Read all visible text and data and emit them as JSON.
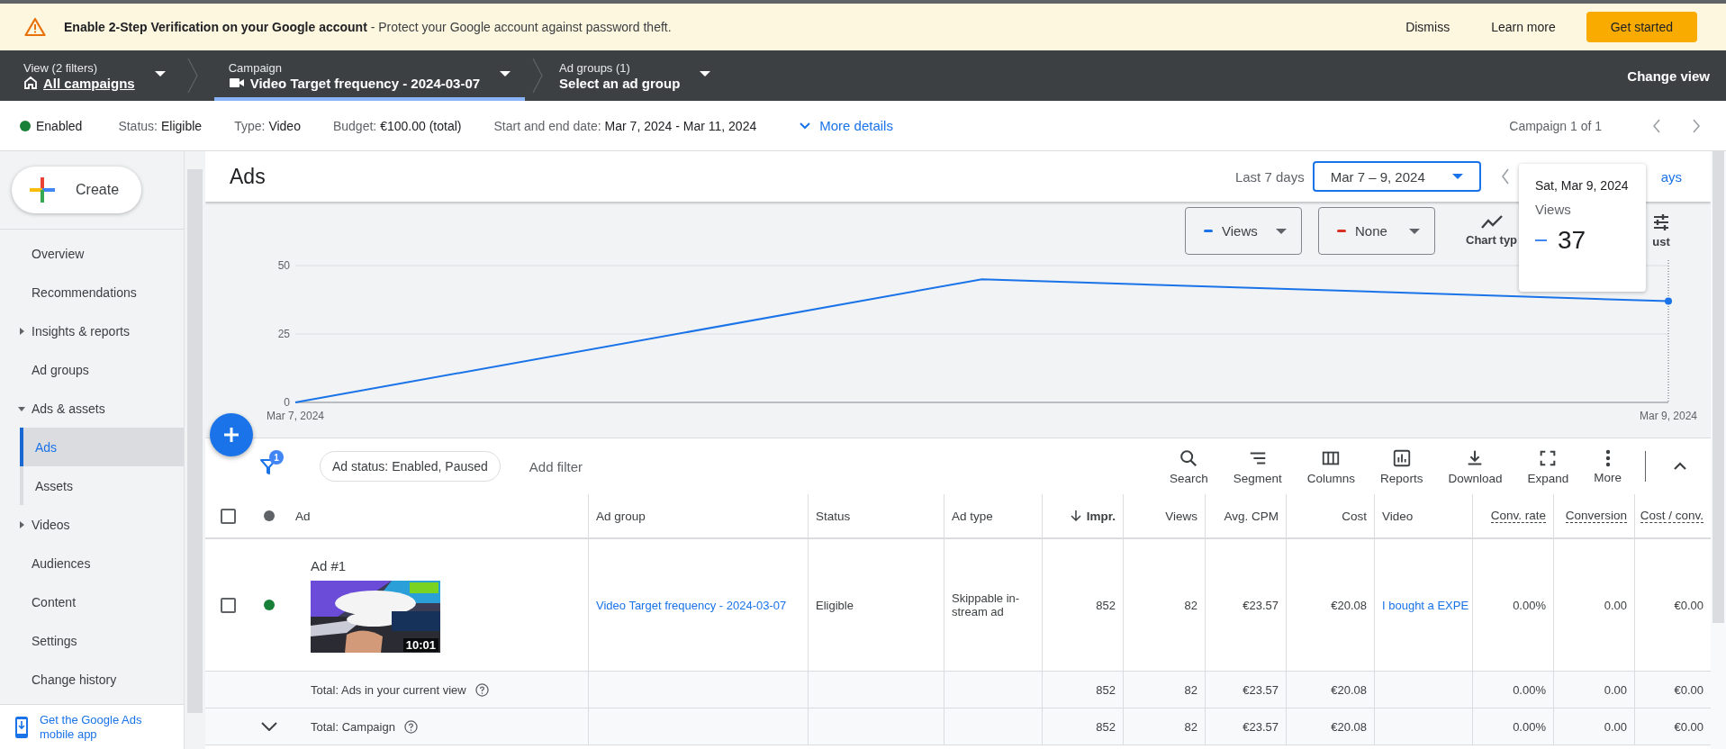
{
  "banner": {
    "title": "Enable 2-Step Verification on your Google account",
    "message": " - Protect your Google account against password theft.",
    "actions": [
      "Dismiss",
      "Learn more"
    ],
    "primary": "Get started"
  },
  "nav": {
    "crumbs": [
      {
        "kind": "view",
        "label": "View (2 filters)",
        "value": "All campaigns",
        "selected": false
      },
      {
        "kind": "campaign",
        "label": "Campaign",
        "value": "Video Target frequency - 2024-03-07",
        "selected": true
      },
      {
        "kind": "adgroup",
        "label": "Ad groups (1)",
        "value": "Select an ad group",
        "selected": false
      }
    ],
    "change_view": "Change view"
  },
  "summary": {
    "state": "Enabled",
    "fields": [
      {
        "label": "Status:",
        "value": "Eligible"
      },
      {
        "label": "Type:",
        "value": "Video"
      },
      {
        "label": "Budget:",
        "value": "€100.00 (total)"
      },
      {
        "label": "Start and end date:",
        "value": "Mar 7, 2024 - Mar 11, 2024"
      }
    ],
    "more": "More details",
    "pager": "Campaign 1 of 1"
  },
  "sidebar": {
    "create": "Create",
    "items": [
      {
        "kind": "link",
        "label": "Overview",
        "selected": false
      },
      {
        "kind": "link",
        "label": "Recommendations",
        "selected": false
      },
      {
        "kind": "group",
        "label": "Insights & reports",
        "expanded": false,
        "selected": false
      },
      {
        "kind": "link",
        "label": "Ad groups",
        "selected": false
      },
      {
        "kind": "group",
        "label": "Ads & assets",
        "expanded": true,
        "selected": false
      },
      {
        "kind": "child",
        "label": "Ads",
        "selected": true
      },
      {
        "kind": "child",
        "label": "Assets",
        "selected": false
      },
      {
        "kind": "group",
        "label": "Videos",
        "expanded": false,
        "selected": false
      },
      {
        "kind": "link",
        "label": "Audiences",
        "selected": false
      },
      {
        "kind": "link",
        "label": "Content",
        "selected": false
      },
      {
        "kind": "link",
        "label": "Settings",
        "selected": false
      },
      {
        "kind": "link",
        "label": "Change history",
        "selected": false
      }
    ],
    "footer": "Get the Google Ads mobile app"
  },
  "page": {
    "title": "Ads",
    "range_label": "Last 7 days",
    "date_range": "Mar 7 – 9, 2024",
    "cut_link": "ays"
  },
  "chart": {
    "metrics": [
      {
        "label": "Views",
        "color": "#1a73e8"
      },
      {
        "label": "None",
        "color": "#d93025"
      }
    ],
    "tools": [
      {
        "kind": "chart-type",
        "label": "Chart typ"
      },
      {
        "kind": "adjust",
        "label": "ust"
      }
    ],
    "tooltip": {
      "date": "Sat, Mar 9, 2024",
      "metric": "Views",
      "value": "37"
    },
    "chart_data": {
      "type": "line",
      "categories": [
        "Mar 7, 2024",
        null,
        "Mar 9, 2024"
      ],
      "series": [
        {
          "color": "#1a73e8",
          "values": [
            0,
            45,
            37
          ]
        }
      ],
      "ylim": [
        0,
        50
      ],
      "yticks": [
        0,
        25,
        50
      ]
    }
  },
  "filters": {
    "count": "1",
    "chip": "Ad status: Enabled, Paused",
    "add": "Add filter"
  },
  "toolbar": [
    {
      "kind": "search",
      "label": "Search"
    },
    {
      "kind": "segment",
      "label": "Segment"
    },
    {
      "kind": "columns",
      "label": "Columns"
    },
    {
      "kind": "reports",
      "label": "Reports"
    },
    {
      "kind": "download",
      "label": "Download"
    },
    {
      "kind": "expand",
      "label": "Expand"
    },
    {
      "kind": "more",
      "label": "More"
    }
  ],
  "table": {
    "all_checked": false,
    "columns": [
      {
        "label": "Ad",
        "kind": "ad",
        "sorted": false
      },
      {
        "label": "Ad group",
        "kind": "link",
        "sorted": false
      },
      {
        "label": "Status",
        "kind": "text",
        "sorted": false
      },
      {
        "label": "Ad type",
        "kind": "text",
        "sorted": false
      },
      {
        "label": "Impr.",
        "kind": "number",
        "sorted": true
      },
      {
        "label": "Views",
        "kind": "number",
        "sorted": false
      },
      {
        "label": "Avg. CPM",
        "kind": "number",
        "sorted": false
      },
      {
        "label": "Cost",
        "kind": "number",
        "sorted": false
      },
      {
        "label": "Video",
        "kind": "link",
        "sorted": false
      },
      {
        "label": "Conv. rate",
        "kind": "metric",
        "sorted": false
      },
      {
        "label": "Conversion",
        "kind": "metric",
        "sorted": false
      },
      {
        "label": "Cost / conv.",
        "kind": "metric",
        "sorted": false
      }
    ],
    "rows": [
      {
        "checked": false,
        "color": "#188038",
        "duration": "10:01",
        "cells": [
          "Ad #1",
          "Video Target frequency - 2024-03-07",
          "Eligible",
          "Skippable in-stream ad",
          "852",
          "82",
          "€23.57",
          "€20.08",
          "I bought a EXPE",
          "0.00%",
          "0.00",
          "€0.00"
        ]
      }
    ],
    "totals": [
      {
        "kind": "view",
        "cells": [
          "Total: Ads in your current view",
          null,
          null,
          null,
          "852",
          "82",
          "€23.57",
          "€20.08",
          null,
          "0.00%",
          "0.00",
          "€0.00"
        ]
      },
      {
        "kind": "campaign",
        "cells": [
          "Total: Campaign",
          null,
          null,
          null,
          "852",
          "82",
          "€23.57",
          "€20.08",
          null,
          "0.00%",
          "0.00",
          "€0.00"
        ]
      }
    ]
  }
}
